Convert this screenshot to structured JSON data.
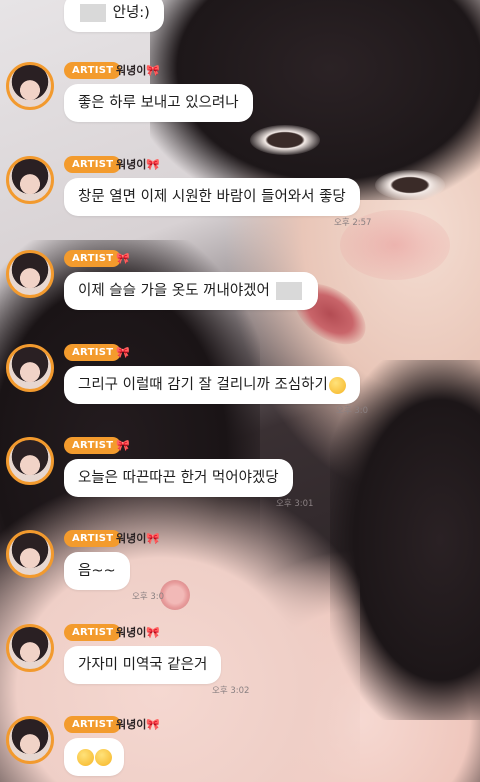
{
  "messages": [
    {
      "text": "안녕:)",
      "has_censor_prefix": true
    },
    {
      "badge": "ARTIST",
      "nickname": "워녕이",
      "text": "좋은 하루 보내고 있으려나"
    },
    {
      "badge": "ARTIST",
      "nickname": "워녕이",
      "text": "창문 열면 이제 시원한 바람이 들어와서 좋당",
      "time": "오후 2:57"
    },
    {
      "badge": "ARTIST",
      "nickname": "",
      "text": "이제 슬슬 가을 옷도 꺼내야겠어",
      "has_censor_suffix": true
    },
    {
      "badge": "ARTIST",
      "nickname": "",
      "text": "그리구 이럴때 감기 잘 걸리니까 조심하기",
      "emoji": "relieved-face",
      "time": "오후 3:0"
    },
    {
      "badge": "ARTIST",
      "nickname": "",
      "text": "오늘은 따끈따끈 한거 먹어야겠당",
      "time": "오후 3:01"
    },
    {
      "badge": "ARTIST",
      "nickname": "워녕이",
      "text": "음~~",
      "time": "오후 3:0"
    },
    {
      "badge": "ARTIST",
      "nickname": "워녕이",
      "text": "가자미 미역국 같은거",
      "time": "오후 3:02"
    },
    {
      "badge": "ARTIST",
      "nickname": "워녕이",
      "text": "",
      "emojis": [
        "smiling-face-with-hand",
        "smiling-face-with-hand"
      ]
    }
  ],
  "icons": {
    "ribbon": "pink-ribbon-icon",
    "emoji": "emoji-face-icon"
  },
  "colors": {
    "badge": "#f39b2d",
    "avatar_ring": "#f29a2e",
    "bubble": "#ffffff",
    "ribbon": "#e6407a"
  }
}
